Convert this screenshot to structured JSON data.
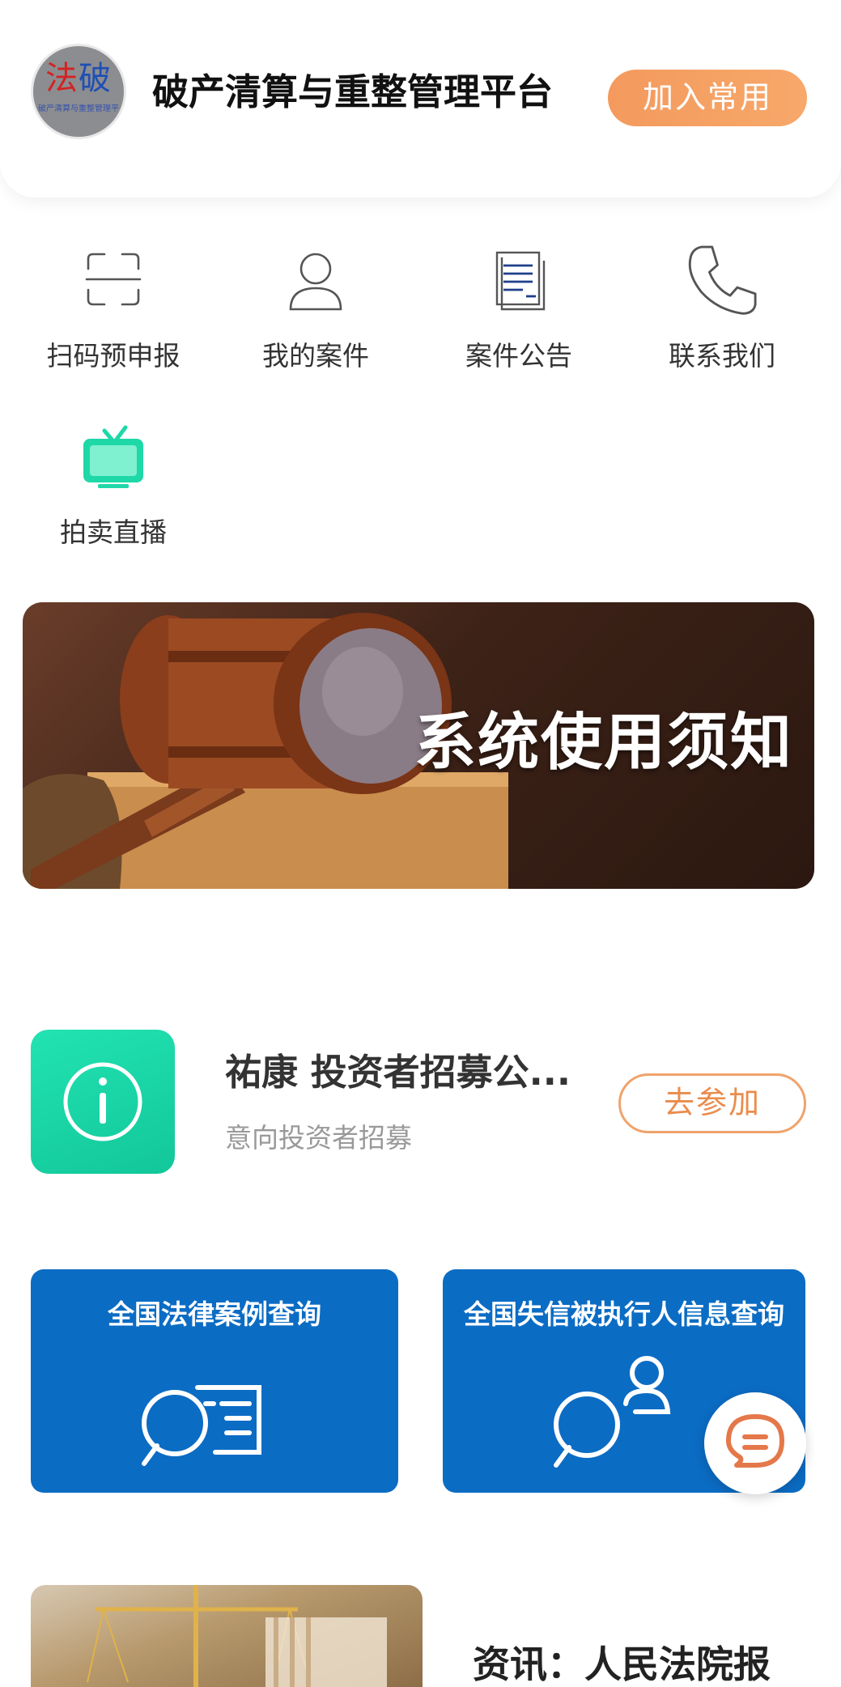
{
  "header": {
    "logo_text_red": "法",
    "logo_text_blue": "破",
    "logo_subtext": "破产清算与重整管理平台",
    "title": "破产清算与重整管理平台",
    "add_favorite_label": "加入常用"
  },
  "quick_actions": [
    {
      "label": "扫码预申报",
      "icon": "scan-icon"
    },
    {
      "label": "我的案件",
      "icon": "user-icon"
    },
    {
      "label": "案件公告",
      "icon": "document-icon"
    },
    {
      "label": "联系我们",
      "icon": "phone-icon"
    },
    {
      "label": "拍卖直播",
      "icon": "tv-icon"
    }
  ],
  "banner": {
    "text": "系统使用须知"
  },
  "notice": {
    "icon": "info-icon",
    "title": "祐康 投资者招募公...",
    "subtitle": "意向投资者招募",
    "action_label": "去参加"
  },
  "query_cards": [
    {
      "title": "全国法律案例查询",
      "icon": "search-document-icon"
    },
    {
      "title": "全国失信被执行人信息查询",
      "icon": "search-person-icon"
    }
  ],
  "chat": {
    "icon": "chat-icon"
  },
  "news": {
    "title": "资讯：人民法院报",
    "image": "scales-of-justice-image"
  },
  "colors": {
    "accent_orange": "#f49a5e",
    "teal": "#1ed8a8",
    "query_blue": "#0b6cc4"
  }
}
